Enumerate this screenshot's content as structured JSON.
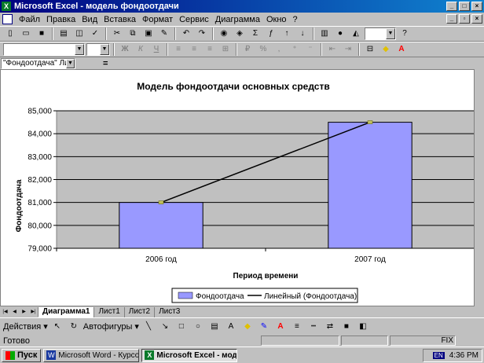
{
  "window": {
    "title": "Microsoft Excel - модель фондоотдачи",
    "app_icon": "X"
  },
  "menu": [
    "Файл",
    "Правка",
    "Вид",
    "Вставка",
    "Формат",
    "Сервис",
    "Диаграмма",
    "Окно",
    "?"
  ],
  "formula_bar": {
    "name_box": "\"Фондоотдача\" Ли...",
    "equals": "="
  },
  "chart_data": {
    "type": "bar",
    "title": "Модель фондоотдачи основных средств",
    "xlabel": "Период времени",
    "ylabel": "Фондоотдача",
    "categories": [
      "2006 год",
      "2007 год"
    ],
    "series": [
      {
        "name": "Фондоотдача",
        "type": "bar",
        "values": [
          81000,
          84500
        ],
        "color": "#9999ff"
      },
      {
        "name": "Линейный (Фондоотдача)",
        "type": "line",
        "values": [
          81000,
          84500
        ],
        "color": "#000000"
      }
    ],
    "ylim": [
      79000,
      85000
    ],
    "yticks": [
      "79,000",
      "80,000",
      "81,000",
      "82,000",
      "83,000",
      "84,000",
      "85,000"
    ],
    "ytick_values": [
      79000,
      80000,
      81000,
      82000,
      83000,
      84000,
      85000
    ],
    "plot_background": "#c0c0c0",
    "grid": true,
    "legend_position": "bottom"
  },
  "sheet_tabs": [
    "Диаграмма1",
    "Лист1",
    "Лист2",
    "Лист3"
  ],
  "drawing_toolbar": {
    "actions": "Действия",
    "autoshapes": "Автофигуры"
  },
  "status": {
    "text": "Готово",
    "fix": "FIX"
  },
  "taskbar": {
    "start": "Пуск",
    "tasks": [
      {
        "label": "Microsoft Word - Курсова...",
        "active": false
      },
      {
        "label": "Microsoft Excel - мод...",
        "active": true
      }
    ],
    "lang": "EN",
    "time": "4:36 PM"
  }
}
